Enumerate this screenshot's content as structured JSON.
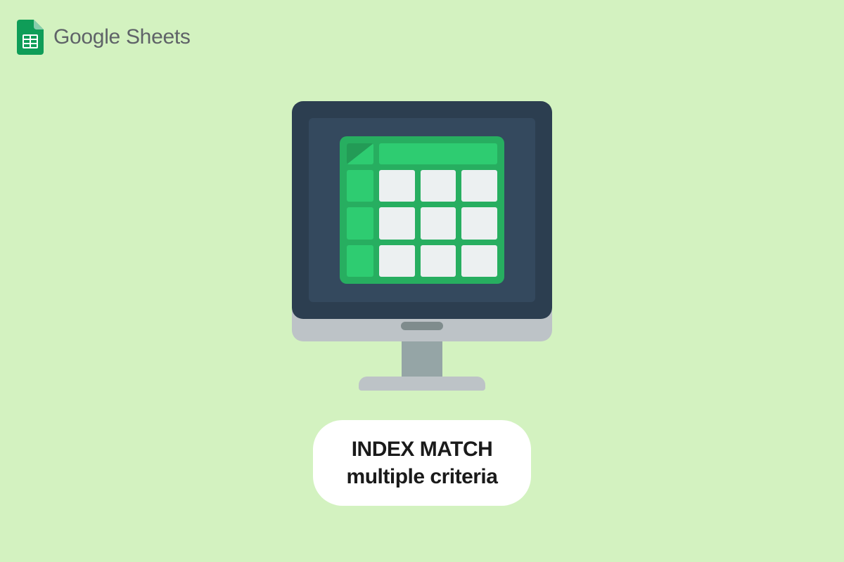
{
  "logo": {
    "product_name": "Google Sheets",
    "icon_name": "google-sheets-icon"
  },
  "illustration": {
    "name": "monitor-spreadsheet-illustration"
  },
  "caption": {
    "line1": "INDEX MATCH",
    "line2": "multiple criteria"
  },
  "colors": {
    "background": "#d3f2c0",
    "sheets_green": "#0f9d58",
    "monitor_dark": "#2c3e50",
    "app_green": "#27ae60",
    "pill_white": "#ffffff"
  }
}
